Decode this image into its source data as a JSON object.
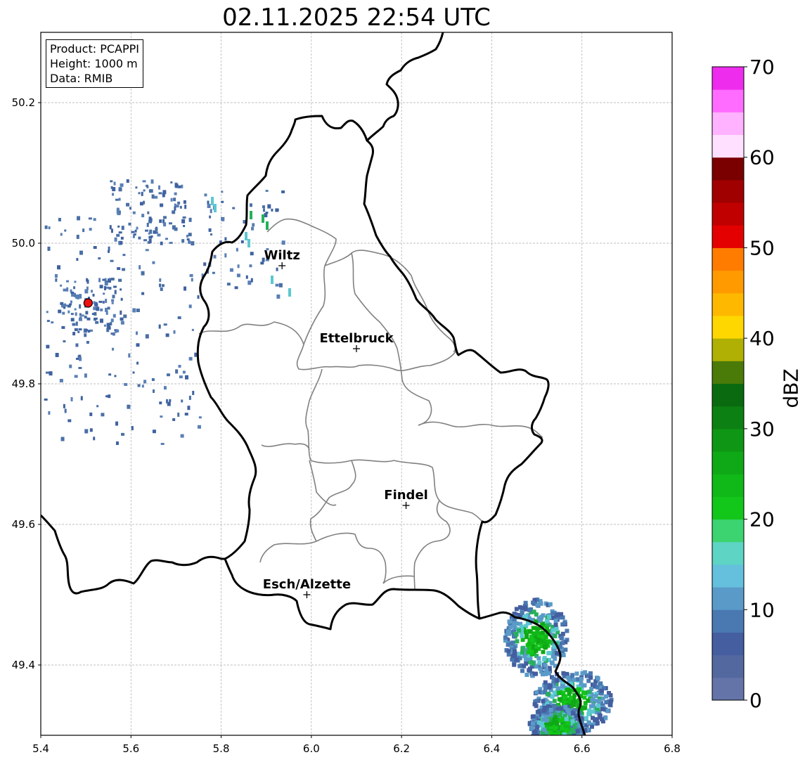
{
  "title": "02.11.2025 22:54 UTC",
  "info": {
    "product": "Product: PCAPPI",
    "height": "Height: 1000 m",
    "data": "Data: RMIB"
  },
  "axes": {
    "x_ticks": [
      "5.4",
      "5.6",
      "5.8",
      "6.0",
      "6.2",
      "6.4",
      "6.6",
      "6.8"
    ],
    "y_ticks": [
      "49.4",
      "49.6",
      "49.8",
      "50.0",
      "50.2"
    ],
    "xlim": [
      5.4,
      6.8
    ],
    "ylim": [
      49.3,
      50.3
    ],
    "grid": true
  },
  "cities": [
    {
      "name": "Wiltz",
      "lon": 5.935,
      "lat": 49.968
    },
    {
      "name": "Ettelbruck",
      "lon": 6.1,
      "lat": 49.85
    },
    {
      "name": "Findel",
      "lon": 6.21,
      "lat": 49.627
    },
    {
      "name": "Esch/Alzette",
      "lon": 5.99,
      "lat": 49.5
    }
  ],
  "radar_site": {
    "lon": 5.505,
    "lat": 49.915,
    "color": "#ee1111"
  },
  "colorbar": {
    "label": "dBZ",
    "ticks": [
      "0",
      "10",
      "20",
      "30",
      "40",
      "50",
      "60",
      "70"
    ],
    "range": [
      0,
      70
    ],
    "colors": [
      "#6474a8",
      "#5468a0",
      "#445e9f",
      "#4a78b0",
      "#5a9ac8",
      "#64c0dc",
      "#5ed4c4",
      "#3cd470",
      "#12c61a",
      "#10b818",
      "#0fa816",
      "#0e9614",
      "#0c8012",
      "#0a6a10",
      "#4a7a08",
      "#b0b004",
      "#ffd700",
      "#ffb800",
      "#ff9a00",
      "#ff7c00",
      "#e40000",
      "#c00000",
      "#a00000",
      "#7a0000",
      "#ffe0ff",
      "#ffb2ff",
      "#ff6cff",
      "#ee2cee"
    ]
  },
  "colors": {
    "border": "#000000",
    "districts": "#808080",
    "grid": "#aaaaaa"
  }
}
